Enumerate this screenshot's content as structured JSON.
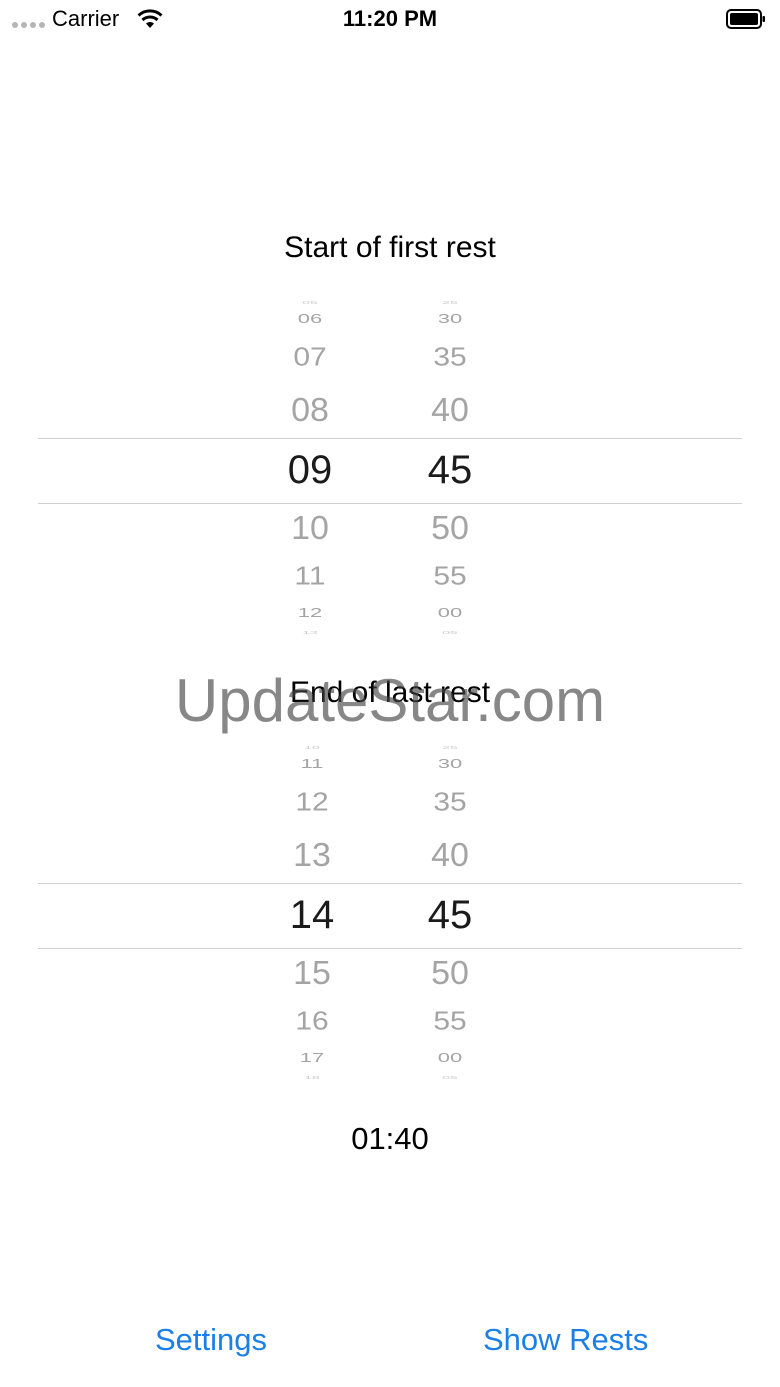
{
  "status_bar": {
    "carrier": "Carrier",
    "time": "11:20 PM"
  },
  "start_picker": {
    "title": "Start of first rest",
    "hours": [
      "05",
      "06",
      "07",
      "08",
      "09",
      "10",
      "11",
      "12",
      "13"
    ],
    "minutes": [
      "25",
      "30",
      "35",
      "40",
      "45",
      "50",
      "55",
      "00",
      "05"
    ],
    "selected_hour": "09",
    "selected_minute": "45"
  },
  "end_picker": {
    "title": "End of last rest",
    "hours": [
      "10",
      "11",
      "12",
      "13",
      "14",
      "15",
      "16",
      "17",
      "18"
    ],
    "minutes": [
      "25",
      "30",
      "35",
      "40",
      "45",
      "50",
      "55",
      "00",
      "05"
    ],
    "selected_hour": "14",
    "selected_minute": "45"
  },
  "duration": "01:40",
  "buttons": {
    "settings": "Settings",
    "show_rests": "Show Rests"
  },
  "watermark": "UpdateStar.com",
  "colors": {
    "accent": "#1a7fe6",
    "wheel_inactive": "#a4a4a4",
    "wheel_selected": "#1b1b1b"
  }
}
